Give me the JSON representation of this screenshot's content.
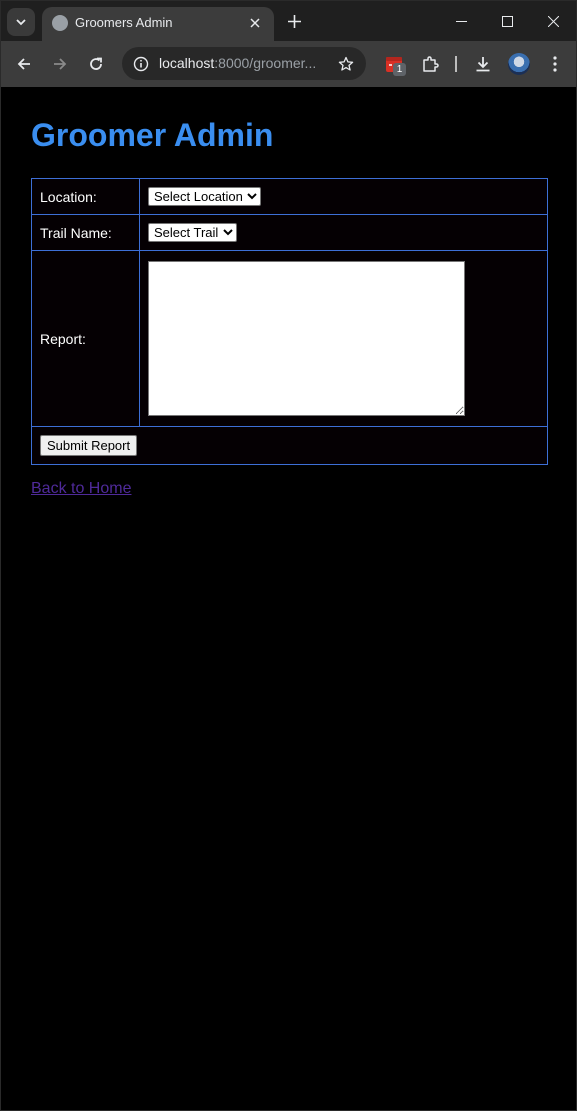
{
  "browser": {
    "tab_title": "Groomers Admin",
    "url_host": "localhost",
    "url_rest": ":8000/groomer...",
    "extension_badge": "1",
    "icons": {
      "tab_search": "chevron-down-icon",
      "favicon": "globe-icon",
      "tab_close": "close-icon",
      "new_tab": "plus-icon",
      "minimize": "minimize-icon",
      "maximize": "maximize-icon",
      "close_window": "close-icon",
      "back": "arrow-left-icon",
      "forward": "arrow-right-icon",
      "reload": "reload-icon",
      "site_info": "info-icon",
      "bookmark": "star-icon",
      "extension": "extension-icon",
      "extensions_menu": "puzzle-icon",
      "download": "download-icon",
      "profile": "avatar-icon",
      "menu": "kebab-menu-icon"
    }
  },
  "page": {
    "title": "Groomer Admin",
    "form": {
      "location_label": "Location:",
      "location_select": "Select Location",
      "trail_label": "Trail Name:",
      "trail_select": "Select Trail",
      "report_label": "Report:",
      "report_value": "",
      "submit_label": "Submit Report"
    },
    "back_link": "Back to Home"
  },
  "colors": {
    "title": "#3a8ef0",
    "table_border": "#3d6fd6",
    "visited_link": "#4f2a9a",
    "background": "#000000"
  }
}
